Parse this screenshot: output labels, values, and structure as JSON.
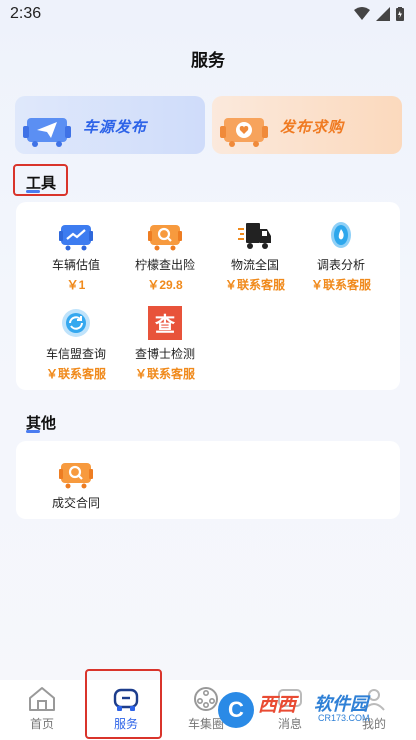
{
  "status_bar": {
    "time": "2:36"
  },
  "header": {
    "title": "服务"
  },
  "publish": {
    "car_source_label": "车源发布",
    "car_request_label": "发布求购"
  },
  "tools": {
    "title": "工具",
    "items": [
      {
        "name": "车辆估值",
        "price": "￥1",
        "icon": "car-chart-icon"
      },
      {
        "name": "柠檬查出险",
        "price": "￥29.8",
        "icon": "car-search-icon"
      },
      {
        "name": "物流全国",
        "price": "￥联系客服",
        "icon": "truck-icon"
      },
      {
        "name": "调表分析",
        "price": "￥联系客服",
        "icon": "drop-icon"
      },
      {
        "name": "车信盟查询",
        "price": "￥联系客服",
        "icon": "refresh-icon"
      },
      {
        "name": "查博士检测",
        "price": "￥联系客服",
        "icon": "cha-logo-icon",
        "logo_char": "查"
      }
    ]
  },
  "other": {
    "title": "其他",
    "items": [
      {
        "name": "成交合同",
        "icon": "car-search-icon"
      }
    ]
  },
  "bottom_nav": {
    "items": [
      {
        "label": "首页",
        "icon": "home-icon"
      },
      {
        "label": "服务",
        "icon": "car-service-icon",
        "active": true
      },
      {
        "label": "车集圈",
        "icon": "circle-icon"
      },
      {
        "label": "消息",
        "icon": "message-icon"
      },
      {
        "label": "我的",
        "icon": "profile-icon"
      }
    ]
  },
  "watermark": {
    "logo": "C",
    "text_a": "西西",
    "text_b": "软件园",
    "sub": "CR173.COM"
  },
  "colors": {
    "accent_blue": "#2d63e8",
    "accent_orange": "#f07b22",
    "price_orange": "#f08a1c",
    "highlight_red": "#d9342b"
  }
}
